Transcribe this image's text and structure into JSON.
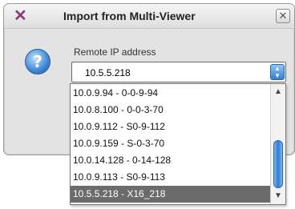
{
  "window": {
    "title": "Import from Multi-Viewer",
    "app_icon": "app-logo-icon",
    "close_glyph": "✕"
  },
  "dialog": {
    "icon": "question-icon",
    "icon_glyph": "?",
    "field_label": "Remote IP address",
    "combo_value": "10.5.5.218"
  },
  "dropdown": {
    "options": [
      "10.0.9.94  -  0-0-9-94",
      "10.0.8.100  -  0-0-3-70",
      "10.0.9.112  -  S0-9-112",
      "10.0.9.159  -  S-0-3-70",
      "10.0.14.128  -  0-14-128",
      "10.0.9.113  -  S0-9-113",
      "10.5.5.218  -  X16_218"
    ],
    "selected_index": 6,
    "scroll_up_glyph": "▲",
    "scroll_down_glyph": "▼"
  }
}
